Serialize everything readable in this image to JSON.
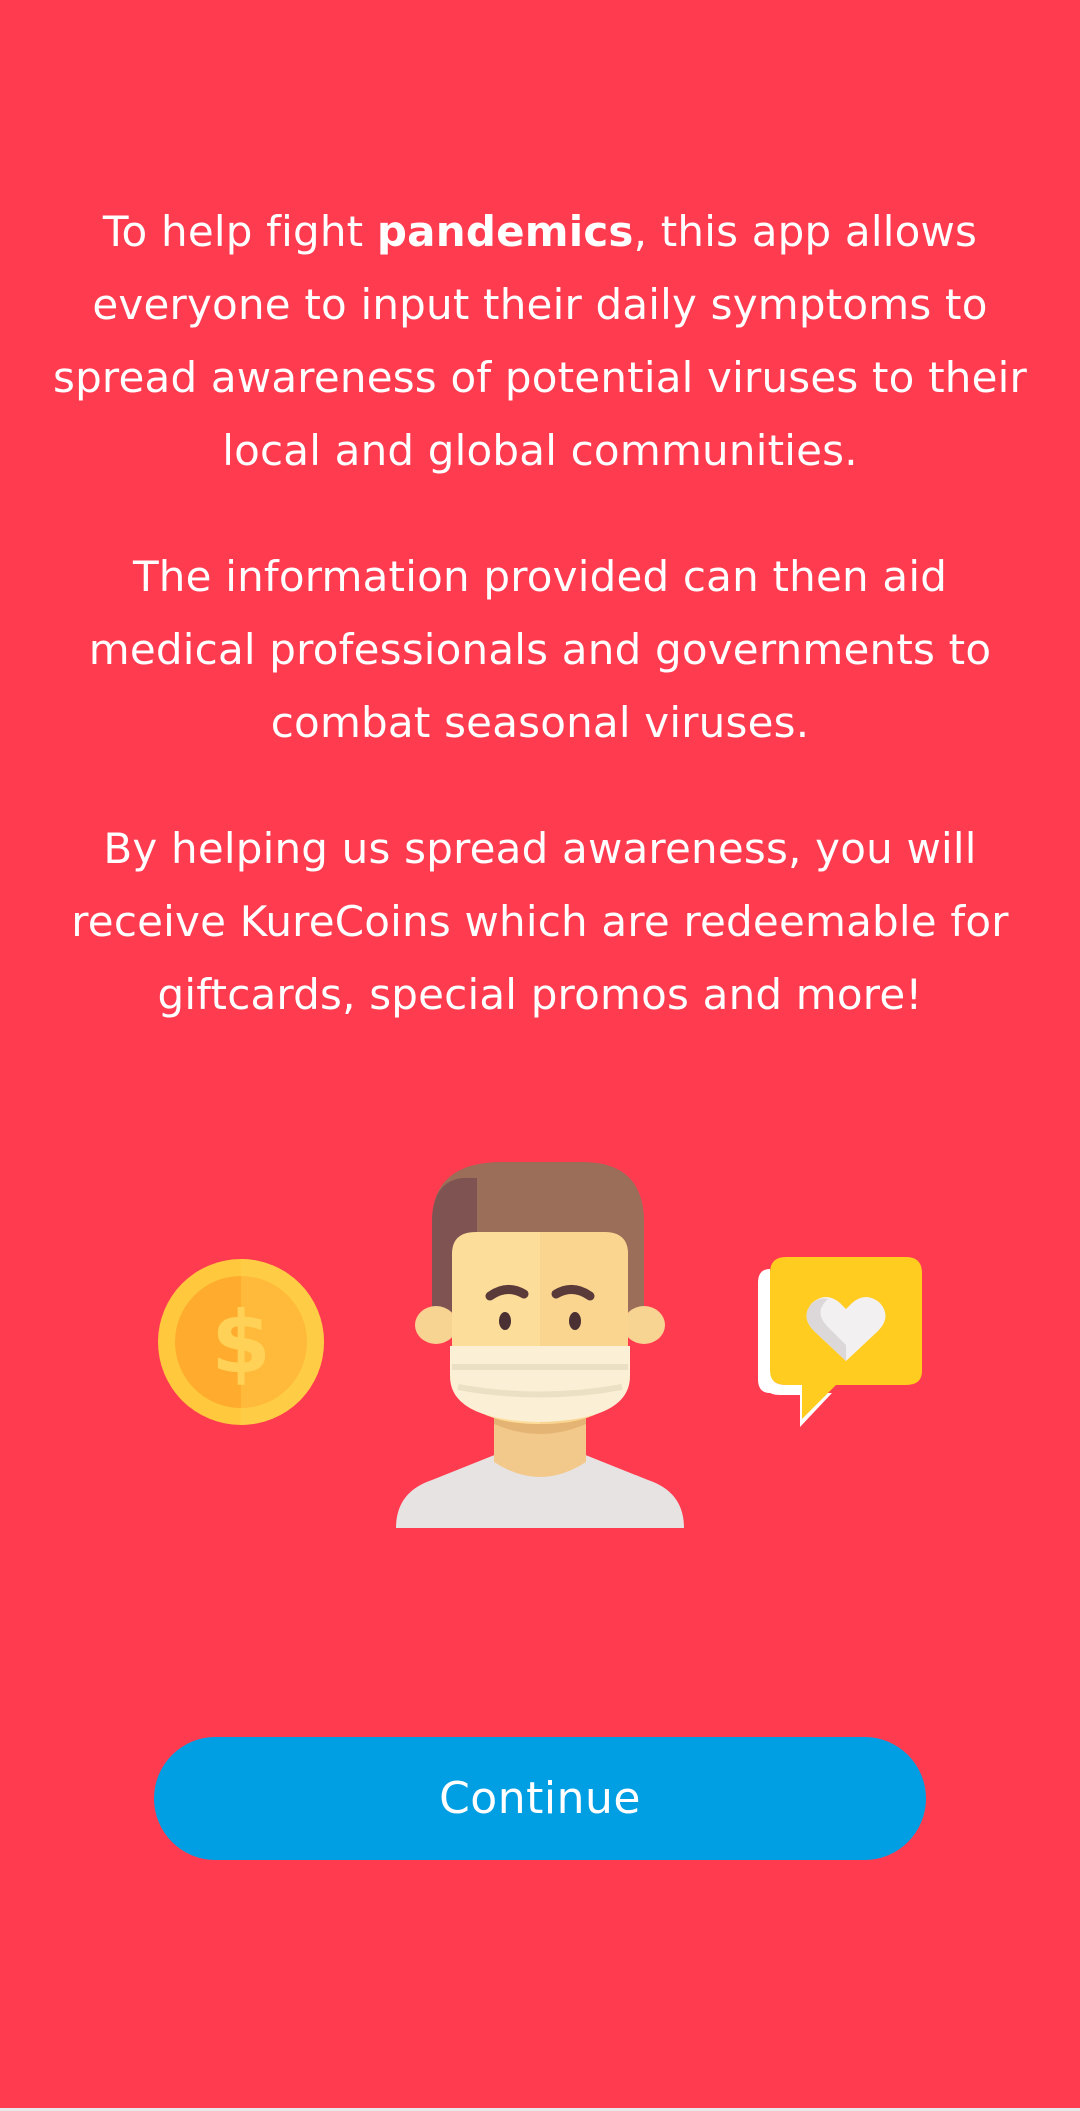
{
  "intro": {
    "p1_before": "To help fight ",
    "p1_bold": "pandemics",
    "p1_line1_after": ", this app allows",
    "p1_line2": "everyone to input their daily symptoms to",
    "p1_line3": "spread awareness of potential viruses to their",
    "p1_line4": "local and global communities.",
    "p2_line1": "The information provided can then aid",
    "p2_line2": "medical professionals and governments to",
    "p2_line3": "combat seasonal viruses.",
    "p3_line1": "By helping us spread awareness, you will",
    "p3_line2": "receive KureCoins which are redeemable for",
    "p3_line3": "giftcards, special promos and more!"
  },
  "illustration": {
    "coin_icon": "dollar-coin-icon",
    "person_icon": "masked-person-icon",
    "chat_icon": "heart-speech-bubble-icon"
  },
  "actions": {
    "continue_label": "Continue"
  },
  "colors": {
    "background": "#ff3b50",
    "button": "#009fe3",
    "text": "#ffffff"
  }
}
